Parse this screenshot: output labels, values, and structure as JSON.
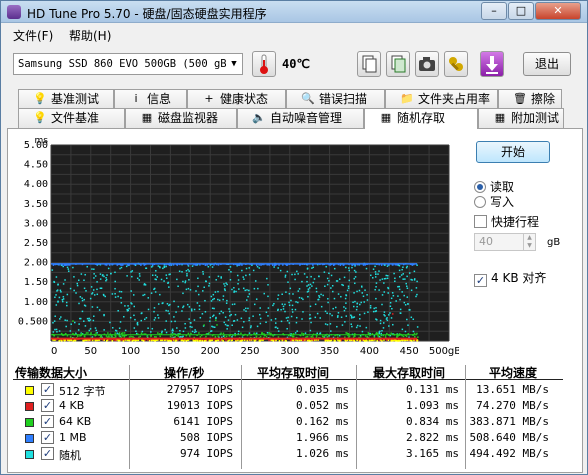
{
  "window": {
    "title": "HD Tune Pro 5.70 - 硬盘/固态硬盘实用程序",
    "minimize": "–",
    "maximize": "□",
    "close": "✕"
  },
  "menu": [
    {
      "label": "文件(F)"
    },
    {
      "label": "帮助(H)"
    }
  ],
  "toolbar": {
    "drive": "Samsung SSD 860 EVO 500GB (500 gB)",
    "temperature": "40℃",
    "exit_label": "退出",
    "icons": [
      "copy-text-icon",
      "copy-info-icon",
      "screenshot-camera-icon",
      "options-wrench-icon",
      "save-download-icon"
    ]
  },
  "tabs_row1": [
    {
      "label": "基准测试",
      "icon": "benchmark-icon",
      "glyph": "💡"
    },
    {
      "label": "信息",
      "icon": "info-icon",
      "glyph": "i"
    },
    {
      "label": "健康状态",
      "icon": "health-icon",
      "glyph": "+"
    },
    {
      "label": "错误扫描",
      "icon": "error-scan-icon",
      "glyph": "🔍"
    },
    {
      "label": "文件夹占用率",
      "icon": "folder-icon",
      "glyph": "📁"
    },
    {
      "label": "擦除",
      "icon": "erase-icon",
      "glyph": "🗑"
    }
  ],
  "tabs_row2": [
    {
      "label": "文件基准",
      "icon": "file-benchmark-icon",
      "glyph": "💡"
    },
    {
      "label": "磁盘监视器",
      "icon": "disk-monitor-icon",
      "glyph": "▦"
    },
    {
      "label": "自动噪音管理",
      "icon": "speaker-icon",
      "glyph": "🔈"
    },
    {
      "label": "随机存取",
      "icon": "random-access-icon",
      "glyph": "▦",
      "active": true
    },
    {
      "label": "附加测试",
      "icon": "extra-tests-icon",
      "glyph": "▦"
    }
  ],
  "controls": {
    "start_label": "开始",
    "read_label": "读取",
    "write_label": "写入",
    "read_selected": true,
    "quick_stroke_label": "快捷行程",
    "quick_stroke_checked": false,
    "quick_stroke_value": "40",
    "quick_stroke_unit": "gB",
    "align_label": "4 KB 对齐",
    "align_checked": true
  },
  "chart_data": {
    "type": "scatter",
    "title": "",
    "xlabel": "",
    "ylabel": "ms",
    "x_unit": "gB",
    "xlim": [
      0,
      500
    ],
    "ylim": [
      0,
      5.0
    ],
    "x_ticks": [
      "0",
      "50",
      "100",
      "150",
      "200",
      "250",
      "300",
      "350",
      "400",
      "450",
      "500gB"
    ],
    "y_ticks": [
      "0.500",
      "1.00",
      "1.50",
      "2.00",
      "2.50",
      "3.00",
      "3.50",
      "4.00",
      "4.50",
      "5.00"
    ],
    "grid": true,
    "background": "#1f1f1f",
    "series": [
      {
        "name": "512 字节",
        "color": "#ffff00",
        "avg_ms": 0.035,
        "max_ms": 0.131
      },
      {
        "name": "4 KB",
        "color": "#e02020",
        "avg_ms": 0.052,
        "max_ms": 1.093
      },
      {
        "name": "64 KB",
        "color": "#20d020",
        "avg_ms": 0.162,
        "max_ms": 0.834
      },
      {
        "name": "1 MB",
        "color": "#2f7fff",
        "avg_ms": 1.966,
        "max_ms": 2.822
      },
      {
        "name": "随机",
        "color": "#20e0e0",
        "avg_ms": 1.026,
        "max_ms": 3.165
      }
    ]
  },
  "results": {
    "headers": [
      "传输数据大小",
      "操作/秒",
      "平均存取时间",
      "最大存取时间",
      "平均速度"
    ],
    "rows": [
      {
        "label": "512 字节",
        "color": "#ffff00",
        "checked": "✓",
        "ops": "27957 IOPS",
        "avg": "0.035 ms",
        "max": "0.131 ms",
        "speed": "13.651 MB/s"
      },
      {
        "label": "4 KB",
        "color": "#e02020",
        "checked": "✓",
        "ops": "19013 IOPS",
        "avg": "0.052 ms",
        "max": "1.093 ms",
        "speed": "74.270 MB/s"
      },
      {
        "label": "64 KB",
        "color": "#20d020",
        "checked": "✓",
        "ops": "6141 IOPS",
        "avg": "0.162 ms",
        "max": "0.834 ms",
        "speed": "383.871 MB/s"
      },
      {
        "label": "1 MB",
        "color": "#2f7fff",
        "checked": "✓",
        "ops": "508 IOPS",
        "avg": "1.966 ms",
        "max": "2.822 ms",
        "speed": "508.640 MB/s"
      },
      {
        "label": "随机",
        "color": "#20e0e0",
        "checked": "✓",
        "ops": "974 IOPS",
        "avg": "1.026 ms",
        "max": "3.165 ms",
        "speed": "494.492 MB/s"
      }
    ]
  }
}
